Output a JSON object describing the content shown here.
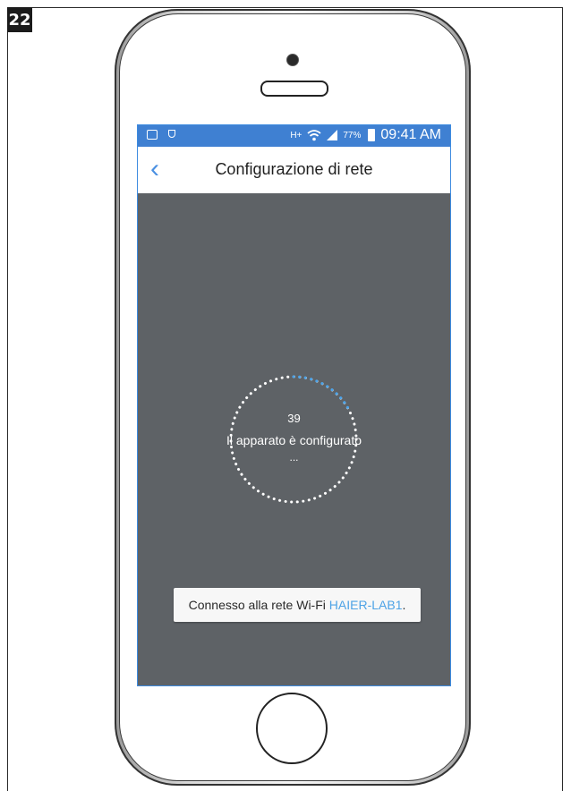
{
  "step": {
    "number": "22"
  },
  "status_bar": {
    "battery_percent": "77%",
    "time": "09:41 AM",
    "data_indicator": "H+"
  },
  "nav": {
    "title": "Configurazione di rete",
    "back_icon": "chevron-left-icon"
  },
  "progress": {
    "count": "39",
    "message": "Il apparato è configurato",
    "ellipsis": "..."
  },
  "toast": {
    "prefix": "Connesso alla rete Wi-Fi ",
    "network": "HAIER-LAB1",
    "suffix": "."
  },
  "colors": {
    "status_bar": "#3f80d2",
    "screen_bg": "#5e6266",
    "accent": "#4a90e2",
    "network_text": "#4ea3e6"
  }
}
